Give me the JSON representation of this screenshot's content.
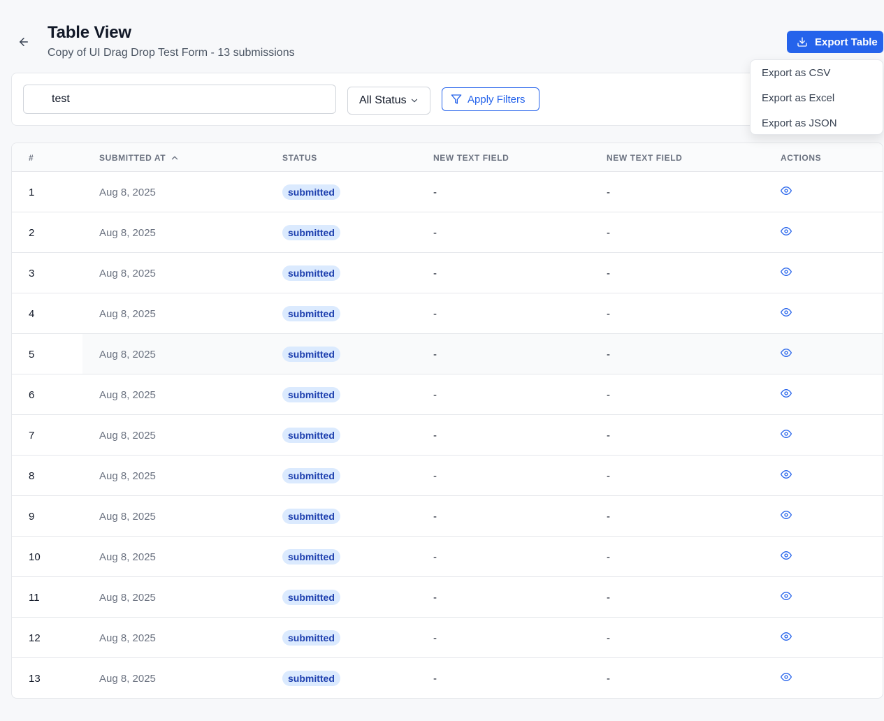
{
  "header": {
    "title": "Table View",
    "subtitle": "Copy of UI Drag Drop Test Form - 13 submissions"
  },
  "export": {
    "button_label": "Export Table",
    "menu": [
      "Export as CSV",
      "Export as Excel",
      "Export as JSON"
    ]
  },
  "filters": {
    "search_value": "test",
    "status_value": "All Status",
    "apply_label": "Apply Filters"
  },
  "table": {
    "columns": [
      "#",
      "SUBMITTED AT",
      "STATUS",
      "NEW TEXT FIELD",
      "NEW TEXT FIELD",
      "ACTIONS"
    ],
    "rows": [
      {
        "num": "1",
        "date": "Aug 8, 2025",
        "status": "submitted",
        "f1": "-",
        "f2": "-"
      },
      {
        "num": "2",
        "date": "Aug 8, 2025",
        "status": "submitted",
        "f1": "-",
        "f2": "-"
      },
      {
        "num": "3",
        "date": "Aug 8, 2025",
        "status": "submitted",
        "f1": "-",
        "f2": "-"
      },
      {
        "num": "4",
        "date": "Aug 8, 2025",
        "status": "submitted",
        "f1": "-",
        "f2": "-"
      },
      {
        "num": "5",
        "date": "Aug 8, 2025",
        "status": "submitted",
        "f1": "-",
        "f2": "-"
      },
      {
        "num": "6",
        "date": "Aug 8, 2025",
        "status": "submitted",
        "f1": "-",
        "f2": "-"
      },
      {
        "num": "7",
        "date": "Aug 8, 2025",
        "status": "submitted",
        "f1": "-",
        "f2": "-"
      },
      {
        "num": "8",
        "date": "Aug 8, 2025",
        "status": "submitted",
        "f1": "-",
        "f2": "-"
      },
      {
        "num": "9",
        "date": "Aug 8, 2025",
        "status": "submitted",
        "f1": "-",
        "f2": "-"
      },
      {
        "num": "10",
        "date": "Aug 8, 2025",
        "status": "submitted",
        "f1": "-",
        "f2": "-"
      },
      {
        "num": "11",
        "date": "Aug 8, 2025",
        "status": "submitted",
        "f1": "-",
        "f2": "-"
      },
      {
        "num": "12",
        "date": "Aug 8, 2025",
        "status": "submitted",
        "f1": "-",
        "f2": "-"
      },
      {
        "num": "13",
        "date": "Aug 8, 2025",
        "status": "submitted",
        "f1": "-",
        "f2": "-"
      }
    ]
  },
  "icons": {
    "back": "arrow-left-icon",
    "export": "download-icon",
    "select": "chevron-down-icon",
    "filter": "filter-icon",
    "sort": "chevron-up-icon",
    "view": "eye-icon"
  },
  "colors": {
    "accent": "#2563eb",
    "badge_bg": "#dbeafe",
    "badge_text": "#1e40af"
  }
}
